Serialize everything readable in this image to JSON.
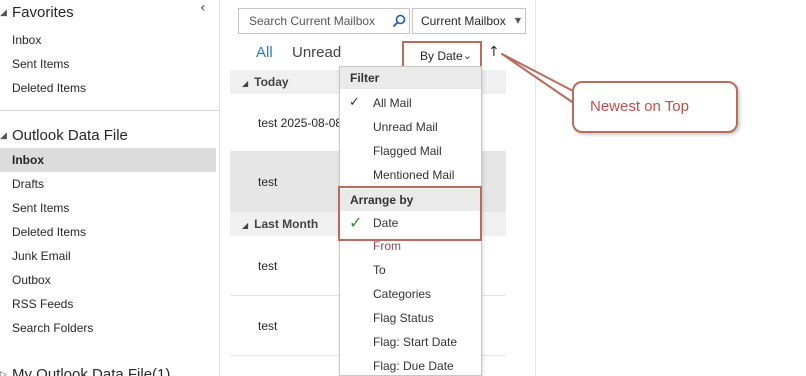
{
  "folder_pane": {
    "collapse_glyph": "‹",
    "favorites": {
      "header": "Favorites",
      "items": [
        "Inbox",
        "Sent Items",
        "Deleted Items"
      ]
    },
    "data_file": {
      "header": "Outlook Data File",
      "items": [
        "Inbox",
        "Drafts",
        "Sent Items",
        "Deleted Items",
        "Junk Email",
        "Outbox",
        "RSS Feeds",
        "Search Folders"
      ],
      "selected": "Inbox"
    },
    "next_store_header": "My Outlook Data File(1)"
  },
  "list_pane": {
    "search": {
      "placeholder": "Search Current Mailbox",
      "scope": "Current Mailbox"
    },
    "tabs": [
      "All",
      "Unread"
    ],
    "active_tab": "All",
    "sort": {
      "label": "By Date",
      "direction_glyph": "↑"
    },
    "groups": [
      {
        "label": "Today",
        "messages": [
          "test 2025-08-08",
          "test"
        ]
      },
      {
        "label": "Last Month",
        "messages": [
          "test",
          "test"
        ]
      }
    ],
    "selected_message": "test"
  },
  "sort_menu": {
    "filter_header": "Filter",
    "filter_items": [
      {
        "label": "All Mail",
        "checked": true
      },
      {
        "label": "Unread Mail",
        "checked": false
      },
      {
        "label": "Flagged Mail",
        "checked": false
      },
      {
        "label": "Mentioned Mail",
        "checked": false
      }
    ],
    "arrange_header": "Arrange by",
    "arrange_items": [
      {
        "label": "Date",
        "checked": true
      },
      {
        "label": "From",
        "checked": false
      },
      {
        "label": "To",
        "checked": false
      },
      {
        "label": "Categories",
        "checked": false
      },
      {
        "label": "Flag Status",
        "checked": false
      },
      {
        "label": "Flag: Start Date",
        "checked": false
      },
      {
        "label": "Flag: Due Date",
        "checked": false
      }
    ]
  },
  "callout": {
    "text": "Newest on Top"
  },
  "colors": {
    "accent": "#2b78c6",
    "annotation": "#b96c5d",
    "callout_text": "#c0504d",
    "check_green": "#3a8a3a"
  },
  "icons": {
    "search": "search-icon",
    "dropdown": "caret-down-icon",
    "check": "checkmark-icon",
    "sort_direction": "arrow-up-icon"
  }
}
